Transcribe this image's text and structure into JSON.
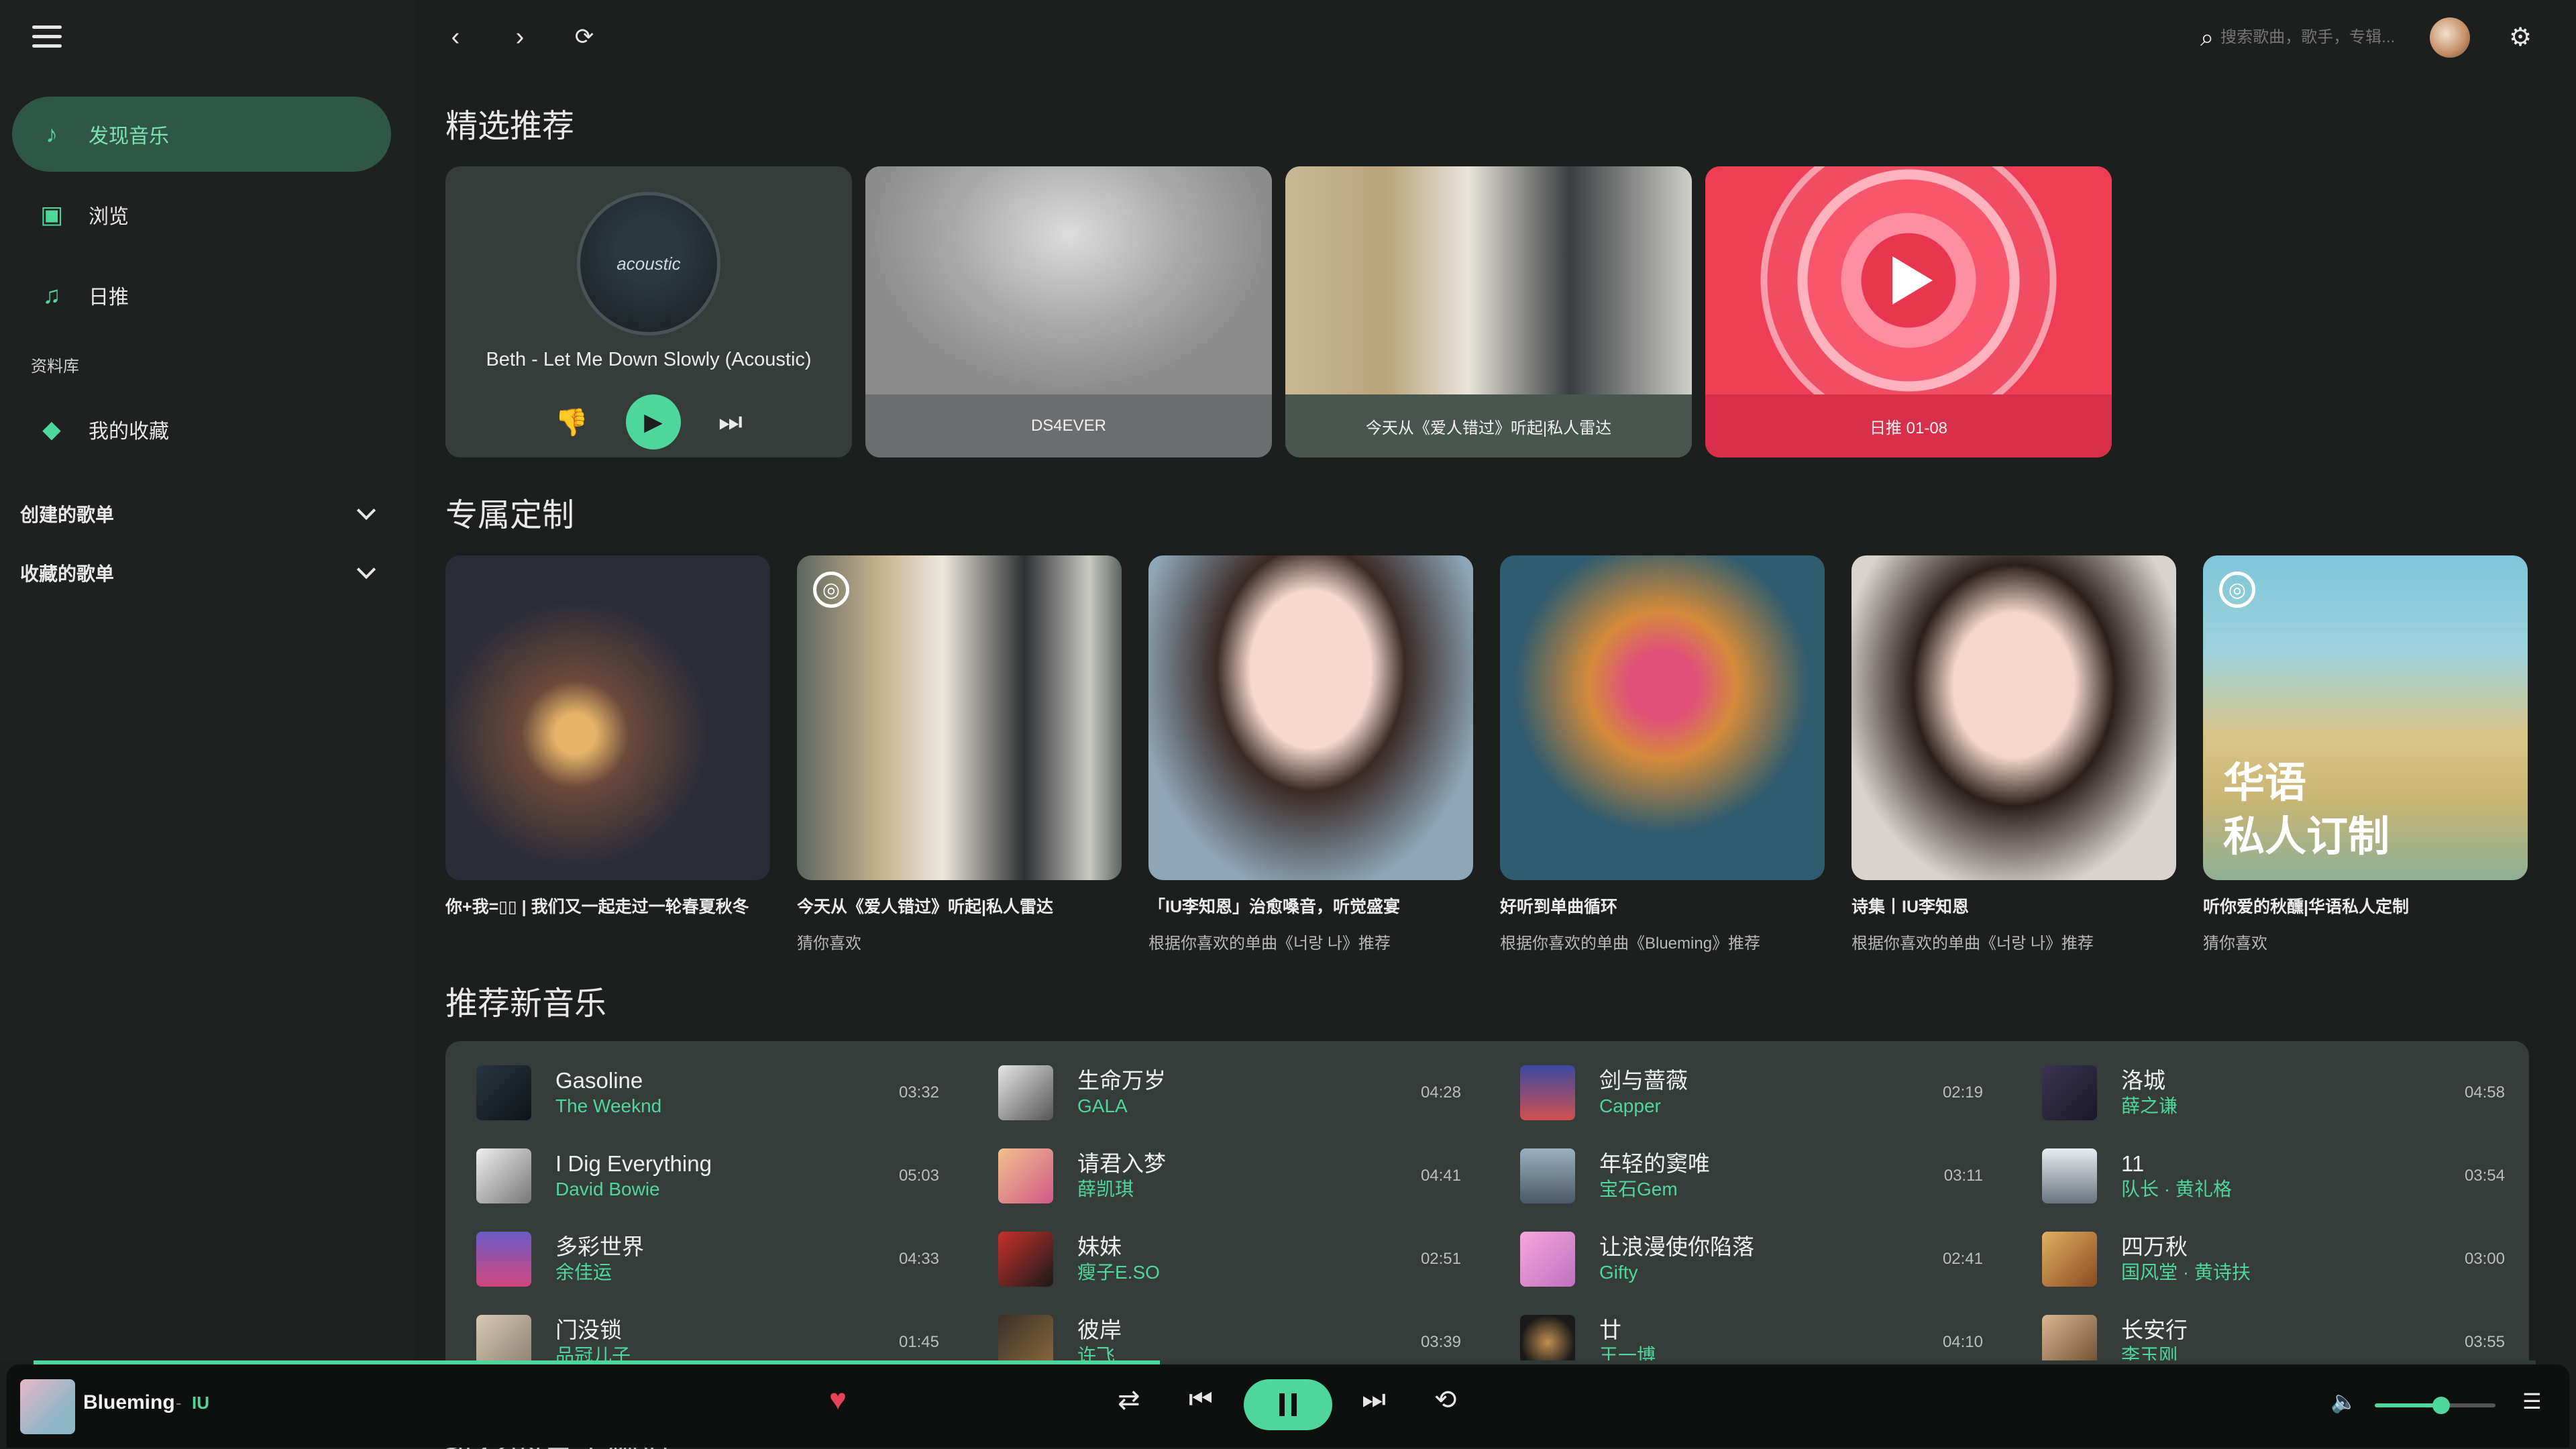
{
  "sidebar": {
    "nav": [
      {
        "label": "发现音乐",
        "icon": "music-note-icon"
      },
      {
        "label": "浏览",
        "icon": "browse-icon"
      },
      {
        "label": "日推",
        "icon": "daily-recommend-icon"
      }
    ],
    "library_label": "资料库",
    "favorites_label": "我的收藏",
    "created_playlists": "创建的歌单",
    "collected_playlists": "收藏的歌单"
  },
  "search": {
    "placeholder": "搜索歌曲，歌手，专辑..."
  },
  "sections": {
    "featured": "精选推荐",
    "custom": "专属定制",
    "new_music": "推荐新音乐",
    "cut_off": "推荐的音乐频道"
  },
  "featured": {
    "player": {
      "disc_text": "acoustic",
      "song": "Beth - Let Me Down Slowly (Acoustic)"
    },
    "cards": [
      {
        "label": "DS4EVER"
      },
      {
        "label": "今天从《爱人错过》听起|私人雷达"
      },
      {
        "label": "日推 01-08"
      }
    ]
  },
  "custom": [
    {
      "title": "你+我=▯▯ | 我们又一起走过一轮春夏秋冬",
      "sub": ""
    },
    {
      "title": "今天从《爱人错过》听起|私人雷达",
      "sub": "猜你喜欢"
    },
    {
      "title": "「IU李知恩」治愈嗓音，听觉盛宴",
      "sub": "根据你喜欢的单曲《너랑 나》推荐"
    },
    {
      "title": "好听到单曲循环",
      "sub": "根据你喜欢的单曲《Blueming》推荐"
    },
    {
      "title": "诗集丨IU李知恩",
      "sub": "根据你喜欢的单曲《너랑 나》推荐"
    },
    {
      "title": "听你爱的秋醺|华语私人定制",
      "sub": "猜你喜欢",
      "overlay": "华语\n私人订制"
    }
  ],
  "songs": [
    {
      "name": "Gasoline",
      "artist": "The Weeknd",
      "dur": "03:32"
    },
    {
      "name": "I Dig Everything",
      "artist": "David Bowie",
      "dur": "05:03"
    },
    {
      "name": "多彩世界",
      "artist": "余佳运",
      "dur": "04:33"
    },
    {
      "name": "门没锁",
      "artist": "品冠儿子",
      "dur": "01:45"
    },
    {
      "name": "生命万岁",
      "artist": "GALA",
      "dur": "04:28"
    },
    {
      "name": "请君入梦",
      "artist": "薛凯琪",
      "dur": "04:41"
    },
    {
      "name": "妹妹",
      "artist": "瘦子E.SO",
      "dur": "02:51"
    },
    {
      "name": "彼岸",
      "artist": "许飞",
      "dur": "03:39"
    },
    {
      "name": "剑与蔷薇",
      "artist": "Capper",
      "dur": "02:19"
    },
    {
      "name": "年轻的窦唯",
      "artist": "宝石Gem",
      "dur": "03:11"
    },
    {
      "name": "让浪漫使你陷落",
      "artist": "Gifty",
      "dur": "02:41"
    },
    {
      "name": "廿",
      "artist": "王一博",
      "dur": "04:10"
    },
    {
      "name": "洛城",
      "artist": "薛之谦",
      "dur": "04:58"
    },
    {
      "name": "11",
      "artist": "队长 · 黄礼格",
      "dur": "03:54"
    },
    {
      "name": "四万秋",
      "artist": "国风堂 · 黄诗扶",
      "dur": "03:00"
    },
    {
      "name": "长安行",
      "artist": "李玉刚",
      "dur": "03:55"
    }
  ],
  "now_playing": {
    "title": "Blueming",
    "sep": "-",
    "artist": "IU",
    "progress": 0.45,
    "volume": 0.55
  },
  "colors": {
    "accent": "#4fd69c",
    "background": "#1c1f1e",
    "card": "#353c39",
    "daily": "#e8364f"
  }
}
